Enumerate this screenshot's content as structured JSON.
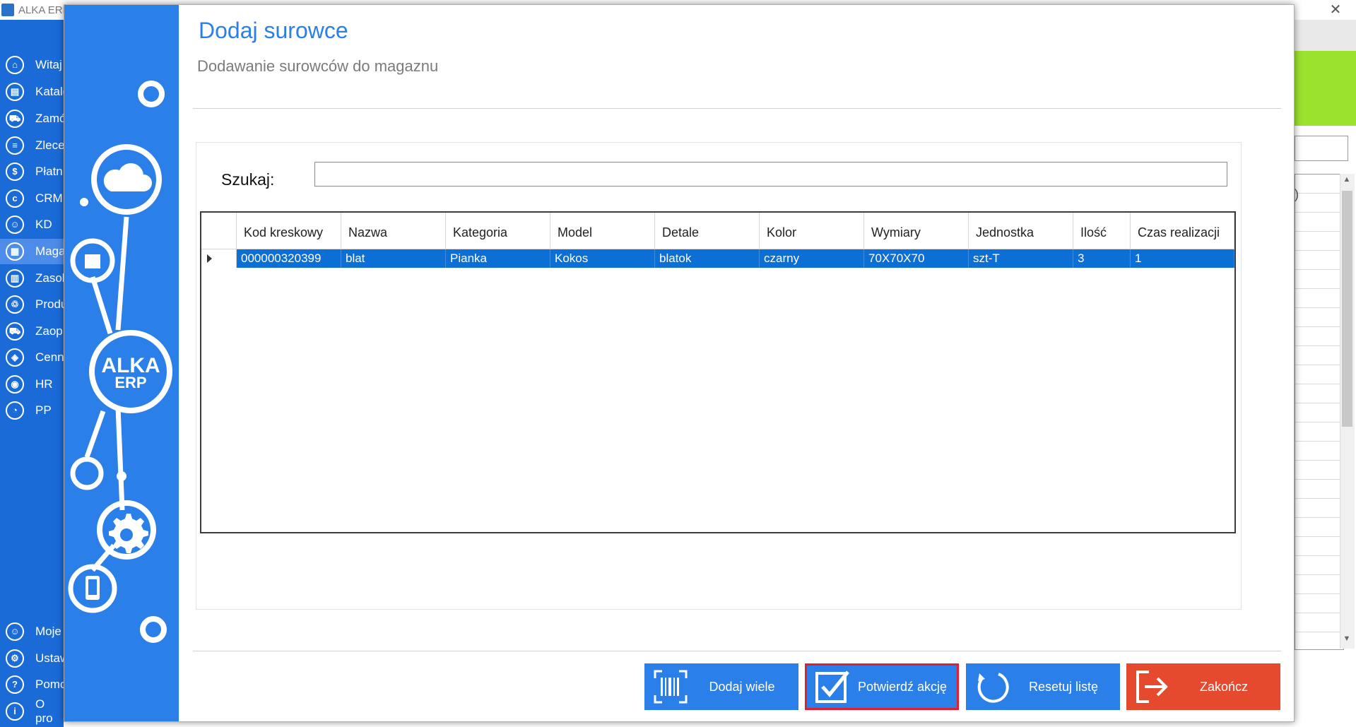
{
  "bg_window": {
    "title": "ALKA ERP",
    "close_glyph": "✕",
    "nav_items": [
      {
        "label": "Witaj",
        "icon": "home-icon",
        "glyph": "⌂"
      },
      {
        "label": "Katalo",
        "icon": "catalog-icon",
        "glyph": "▤"
      },
      {
        "label": "Zamó",
        "icon": "cart-icon",
        "glyph": "⛟"
      },
      {
        "label": "Zlece",
        "icon": "list-icon",
        "glyph": "≡"
      },
      {
        "label": "Płatn",
        "icon": "dollar-icon",
        "glyph": "$"
      },
      {
        "label": "CRM",
        "icon": "crm-icon",
        "glyph": "c"
      },
      {
        "label": "KD",
        "icon": "person-icon",
        "glyph": "☺"
      },
      {
        "label": "Maga",
        "icon": "warehouse-icon",
        "glyph": "▦"
      },
      {
        "label": "Zasob",
        "icon": "resources-icon",
        "glyph": "▥"
      },
      {
        "label": "Produ",
        "icon": "production-icon",
        "glyph": "♲"
      },
      {
        "label": "Zaop",
        "icon": "truck-icon",
        "glyph": "⛟"
      },
      {
        "label": "Cenn",
        "icon": "tag-icon",
        "glyph": "◈"
      },
      {
        "label": "HR",
        "icon": "hr-icon",
        "glyph": "◉"
      },
      {
        "label": "PP",
        "icon": "pp-icon",
        "glyph": "◔"
      }
    ],
    "bottom_nav_items": [
      {
        "label": "Moje",
        "icon": "user-icon",
        "glyph": "☺"
      },
      {
        "label": "Ustaw",
        "icon": "settings-icon",
        "glyph": "⚙"
      },
      {
        "label": "Pomo",
        "icon": "help-icon",
        "glyph": "?"
      },
      {
        "label": "O pro",
        "icon": "info-icon",
        "glyph": "i"
      }
    ],
    "right_grid_fragment": ")",
    "scroll_up": "▲",
    "scroll_down": "▼"
  },
  "dialog": {
    "title": "Dodaj surowce",
    "subtitle": "Dodawanie surowców do magaznu",
    "banner_logo_line1": "ALKA",
    "banner_logo_line2": "ERP",
    "search": {
      "label": "Szukaj:",
      "value": "",
      "placeholder": ""
    },
    "grid": {
      "columns": [
        "Kod kreskowy",
        "Nazwa",
        "Kategoria",
        "Model",
        "Detale",
        "Kolor",
        "Wymiary",
        "Jednostka",
        "Ilość",
        "Czas realizacji"
      ],
      "rows": [
        [
          "000000320399",
          "blat",
          "Pianka",
          "Kokos",
          "blatok",
          "czarny",
          "70X70X70",
          "szt-T",
          "3",
          "1"
        ]
      ]
    },
    "buttons": {
      "add_many": "Dodaj wiele",
      "confirm": "Potwierdź akcję",
      "reset": "Resetuj listę",
      "finish": "Zakończ"
    }
  },
  "colors": {
    "accent": "#2b7fe8",
    "sidebar": "#1a6bd8",
    "selection": "#0b6fd6",
    "finish_button": "#e64a2e",
    "confirm_border": "#e0202e",
    "green_panel": "#9be22f"
  }
}
